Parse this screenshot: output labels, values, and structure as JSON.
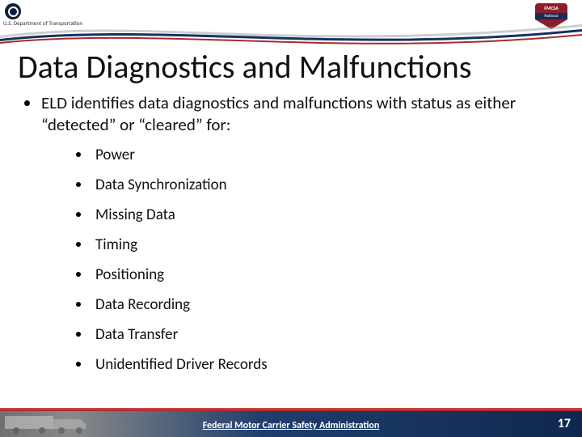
{
  "header": {
    "dot_text": "U.S. Department of Transportation",
    "badge_top": "FMCSA",
    "badge_mid": "National"
  },
  "title": "Data Diagnostics and Malfunctions",
  "lead_text": "ELD identifies data diagnostics and malfunctions with status as either “detected” or “cleared” for:",
  "items": [
    "Power",
    "Data Synchronization",
    "Missing Data",
    "Timing",
    "Positioning",
    "Data Recording",
    "Data Transfer",
    "Unidentified Driver Records"
  ],
  "footer": {
    "org": "Federal Motor Carrier Safety Administration",
    "page": "17"
  }
}
